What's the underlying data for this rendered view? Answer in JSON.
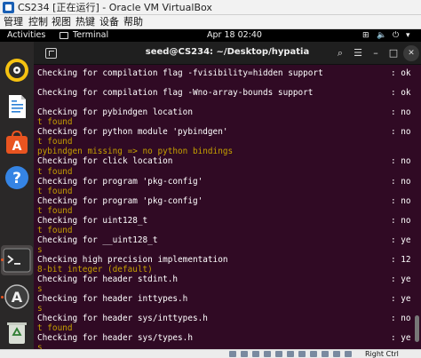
{
  "vbox": {
    "title": "CS234 [正在运行] - Oracle VM VirtualBox",
    "menu": [
      "管理",
      "控制",
      "视图",
      "热键",
      "设备",
      "帮助"
    ],
    "host_key": "Right Ctrl"
  },
  "gnome": {
    "activities": "Activities",
    "app_name": "Terminal",
    "clock": "Apr 18  02:40",
    "tray": [
      "network-icon",
      "volume-icon",
      "power-icon",
      "chevron-down-icon"
    ]
  },
  "dock": [
    "rhythmbox-icon",
    "writer-icon",
    "software-icon",
    "help-icon",
    "terminal-icon",
    "software-updater-icon",
    "trash-icon",
    "dvd-icon"
  ],
  "terminal": {
    "title": "seed@CS234: ~/Desktop/hypatia",
    "lines": [
      {
        "text": "Checking for compilation flag -fvisibility=hidden support",
        "result": ": ok",
        "warn": false
      },
      {
        "text": "",
        "result": "",
        "warn": false
      },
      {
        "text": "Checking for compilation flag -Wno-array-bounds support",
        "result": ": ok",
        "warn": false
      },
      {
        "text": "",
        "result": "",
        "warn": false
      },
      {
        "text": "Checking for pybindgen location",
        "result": ": no",
        "warn": false
      },
      {
        "text": "t found",
        "result": "",
        "warn": true
      },
      {
        "text": "Checking for python module 'pybindgen'",
        "result": ": no",
        "warn": false
      },
      {
        "text": "t found",
        "result": "",
        "warn": true
      },
      {
        "text": "pybindgen missing => no python bindings",
        "result": "",
        "warn": true
      },
      {
        "text": "Checking for click location",
        "result": ": no",
        "warn": false
      },
      {
        "text": "t found",
        "result": "",
        "warn": true
      },
      {
        "text": "Checking for program 'pkg-config'",
        "result": ": no",
        "warn": false
      },
      {
        "text": "t found",
        "result": "",
        "warn": true
      },
      {
        "text": "Checking for program 'pkg-config'",
        "result": ": no",
        "warn": false
      },
      {
        "text": "t found",
        "result": "",
        "warn": true
      },
      {
        "text": "Checking for uint128_t",
        "result": ": no",
        "warn": false
      },
      {
        "text": "t found",
        "result": "",
        "warn": true
      },
      {
        "text": "Checking for __uint128_t",
        "result": ": ye",
        "warn": false
      },
      {
        "text": "s",
        "result": "",
        "warn": true
      },
      {
        "text": "Checking high precision implementation",
        "result": ": 12",
        "warn": false
      },
      {
        "text": "8-bit integer (default)",
        "result": "",
        "warn": true
      },
      {
        "text": "Checking for header stdint.h",
        "result": ": ye",
        "warn": false
      },
      {
        "text": "s",
        "result": "",
        "warn": true
      },
      {
        "text": "Checking for header inttypes.h",
        "result": ": ye",
        "warn": false
      },
      {
        "text": "s",
        "result": "",
        "warn": true
      },
      {
        "text": "Checking for header sys/inttypes.h",
        "result": ": no",
        "warn": false
      },
      {
        "text": "t found",
        "result": "",
        "warn": true
      },
      {
        "text": "Checking for header sys/types.h",
        "result": ": ye",
        "warn": false
      },
      {
        "text": "s",
        "result": "",
        "warn": true
      }
    ]
  },
  "colors": {
    "terminal_bg": "#300a24",
    "warn_text": "#c4a000",
    "accent": "#e95420"
  }
}
